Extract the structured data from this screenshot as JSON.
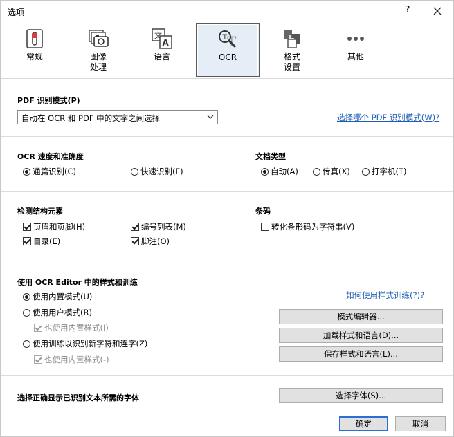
{
  "window": {
    "title": "选项",
    "help_label": "?"
  },
  "toolbar": {
    "tabs": [
      {
        "label": "常规",
        "icon": "general-settings-icon"
      },
      {
        "label": "图像\n处理",
        "icon": "image-processing-icon"
      },
      {
        "label": "语言",
        "icon": "language-icon"
      },
      {
        "label": "OCR",
        "icon": "ocr-magnifier-icon",
        "active": true
      },
      {
        "label": "格式\n设置",
        "icon": "format-settings-icon"
      },
      {
        "label": "其他",
        "icon": "more-dots-icon"
      }
    ]
  },
  "pdf_mode": {
    "header": "PDF 识别模式(P)",
    "selected": "自动在 OCR 和 PDF 中的文字之间选择",
    "help_link": "选择哪个 PDF 识别模式(W)?"
  },
  "speed": {
    "header": "OCR 速度和准确度",
    "options": [
      "通篇识别(C)",
      "快速识别(F)"
    ],
    "selected_index": 0
  },
  "doc_type": {
    "header": "文档类型",
    "options": [
      "自动(A)",
      "传真(X)",
      "打字机(T)"
    ],
    "selected_index": 0
  },
  "structure": {
    "header": "检测结构元素",
    "items": [
      {
        "label": "页眉和页脚(H)",
        "checked": true
      },
      {
        "label": "编号列表(M)",
        "checked": true
      },
      {
        "label": "目录(E)",
        "checked": true
      },
      {
        "label": "脚注(O)",
        "checked": true
      }
    ]
  },
  "barcode": {
    "header": "条码",
    "label": "转化条形码为字符串(V)",
    "checked": false
  },
  "patterns": {
    "header": "使用 OCR Editor 中的样式和训练",
    "help_link": "如何使用样式训练(?)?",
    "options": [
      "使用内置模式(U)",
      "使用用户模式(R)",
      "使用训练以识别新字符和连字(Z)"
    ],
    "selected_index": 0,
    "sub1": "也使用内置样式(I)",
    "sub2": "也使用内置样式(-)",
    "buttons": [
      "模式编辑器...",
      "加载样式和语言(D)...",
      "保存样式和语言(L)..."
    ]
  },
  "fonts": {
    "label": "选择正确显示已识别文本所需的字体",
    "button": "选择字体(S)..."
  },
  "footer": {
    "ok": "确定",
    "cancel": "取消"
  },
  "colors": {
    "accent": "#2b6ed6",
    "link": "#1d5fb5",
    "active_tab_bg": "#e5eef6"
  }
}
